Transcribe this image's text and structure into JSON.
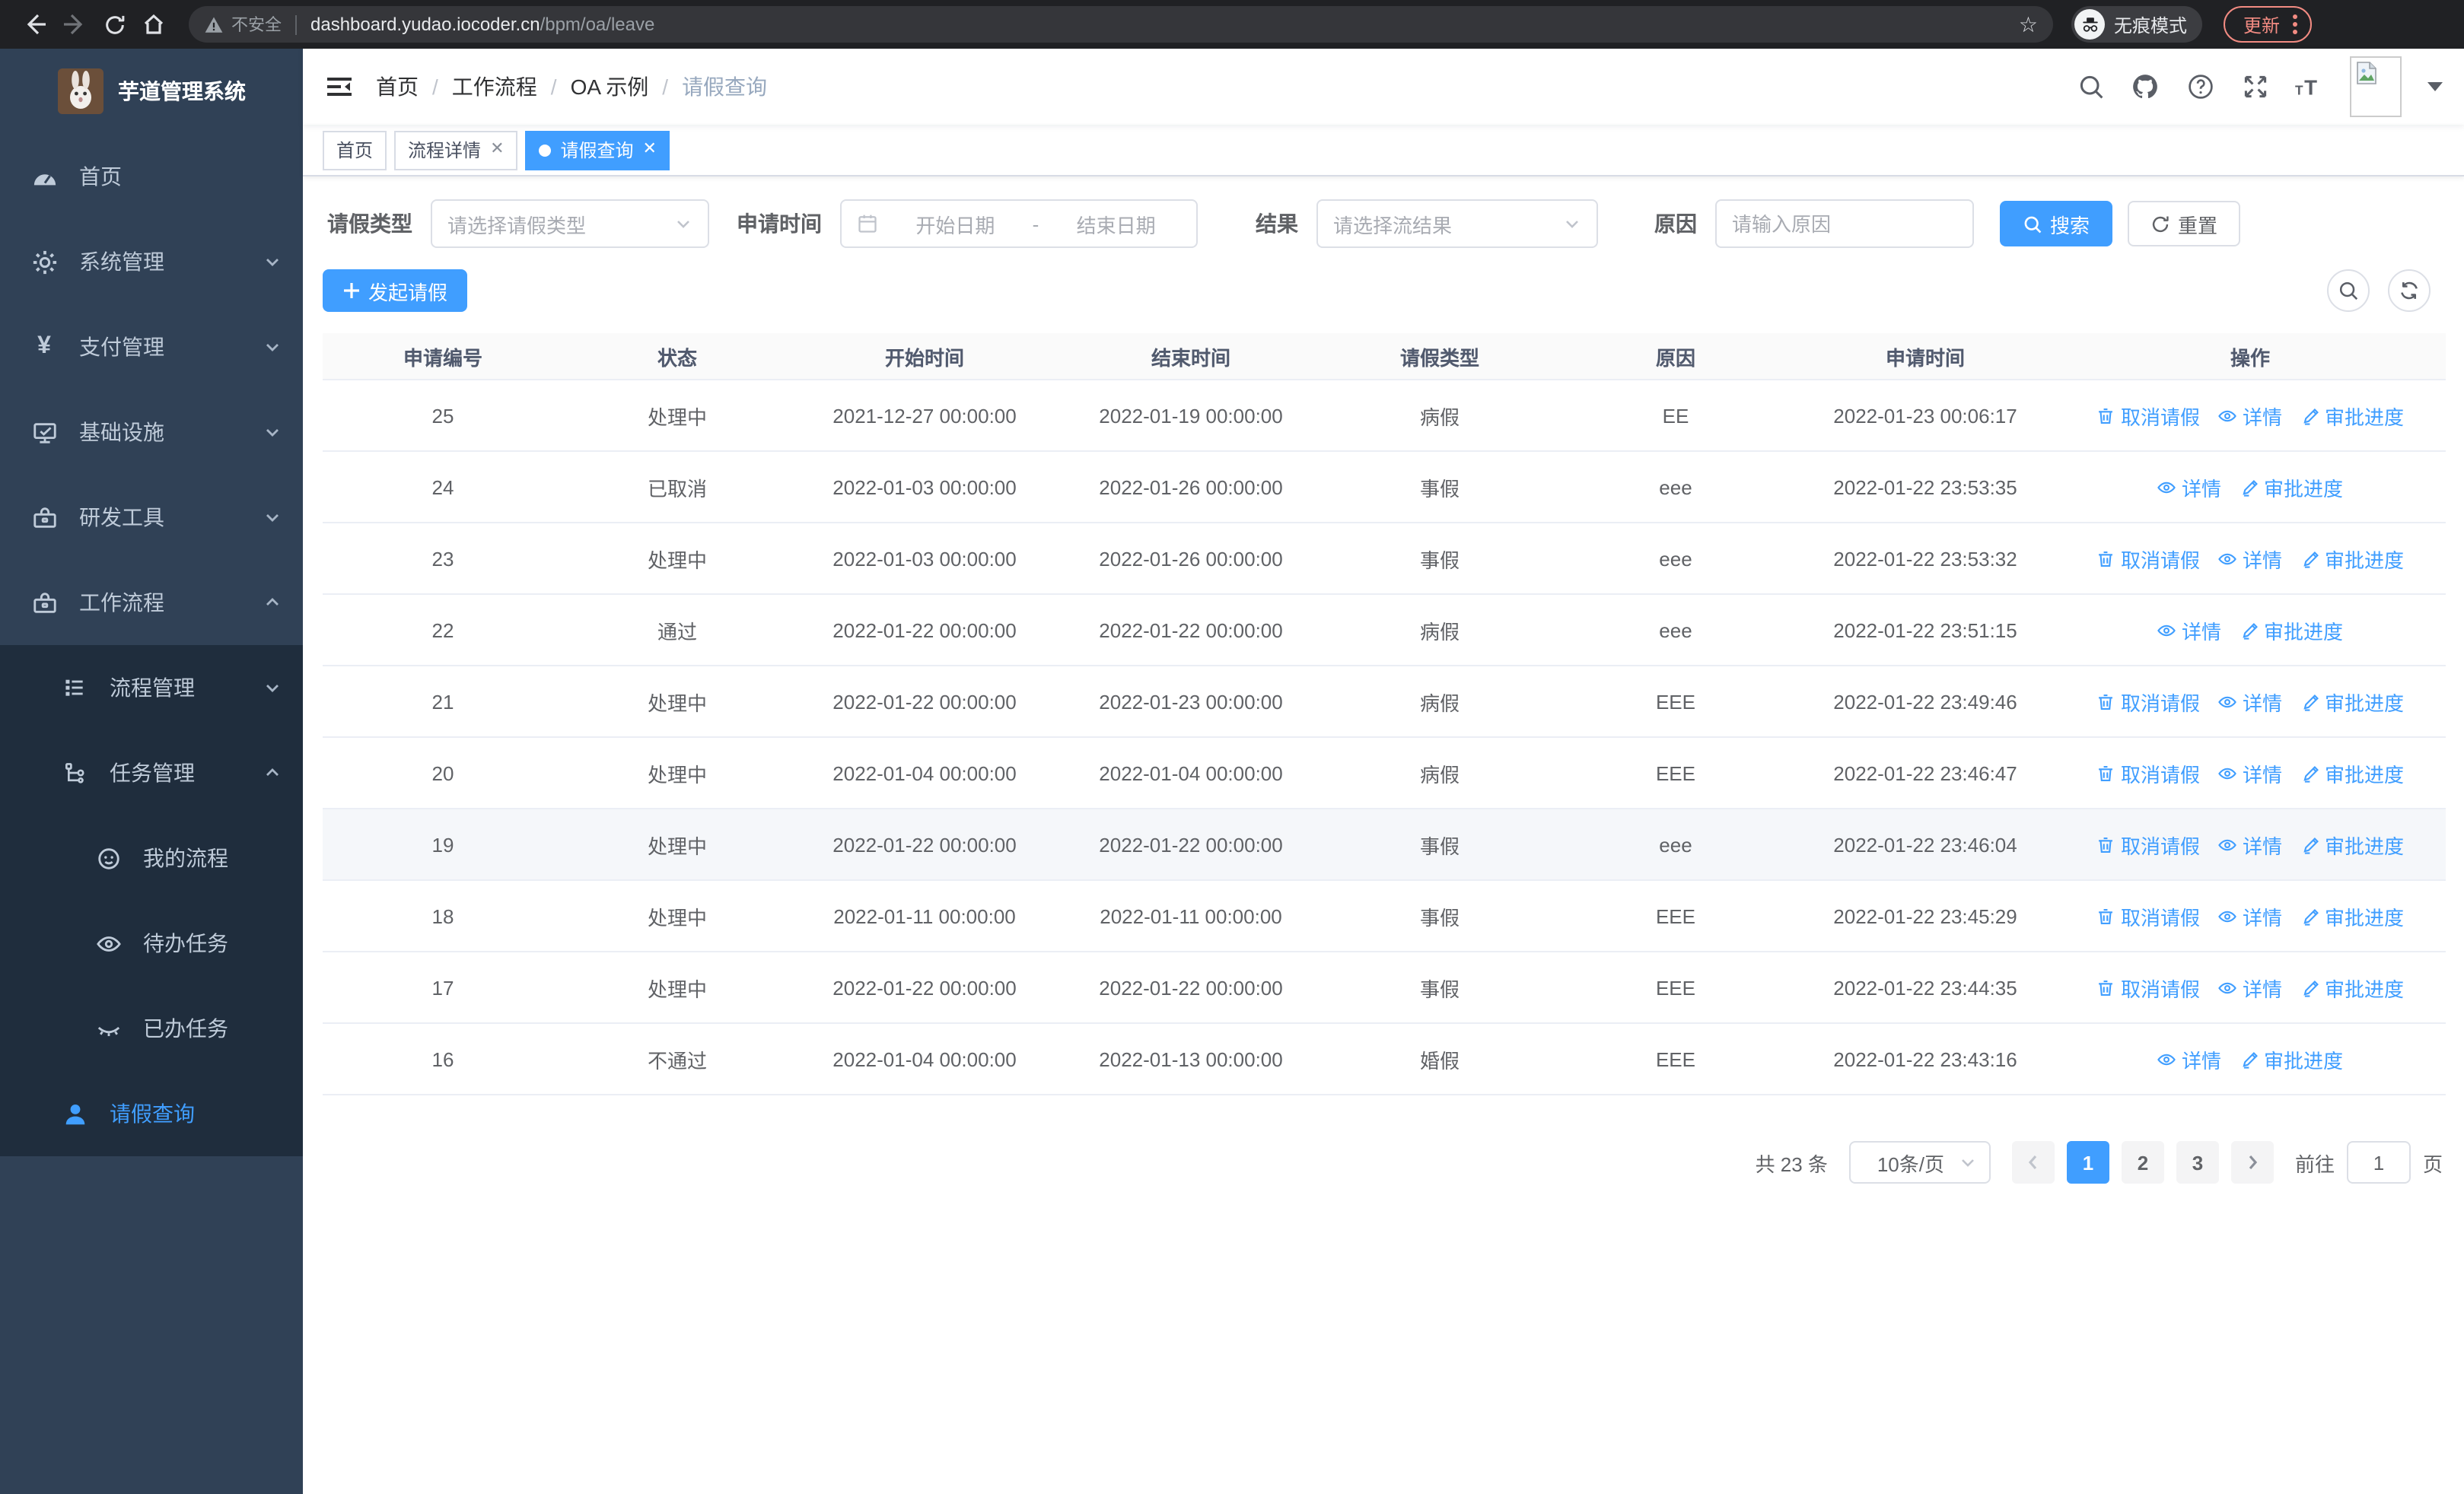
{
  "browser": {
    "security_label": "不安全",
    "url_host": "dashboard.yudao.iocoder.cn",
    "url_path": "/bpm/oa/leave",
    "incognito_label": "无痕模式",
    "update_label": "更新"
  },
  "sidebar": {
    "title": "芋道管理系统",
    "items": [
      {
        "label": "首页",
        "icon": "dashboard-icon"
      },
      {
        "label": "系统管理",
        "icon": "gear-icon"
      },
      {
        "label": "支付管理",
        "icon": "yen-icon"
      },
      {
        "label": "基础设施",
        "icon": "monitor-icon"
      },
      {
        "label": "研发工具",
        "icon": "toolbox-icon"
      },
      {
        "label": "工作流程",
        "icon": "briefcase-icon"
      }
    ],
    "workflow_children": [
      {
        "label": "流程管理",
        "icon": "list-icon"
      },
      {
        "label": "任务管理",
        "icon": "flow-icon"
      },
      {
        "label": "我的流程",
        "icon": "face-icon"
      },
      {
        "label": "待办任务",
        "icon": "eye-icon"
      },
      {
        "label": "已办任务",
        "icon": "eye-closed-icon"
      },
      {
        "label": "请假查询",
        "icon": "user-icon"
      }
    ]
  },
  "navbar": {
    "breadcrumb": [
      "首页",
      "工作流程",
      "OA 示例",
      "请假查询"
    ]
  },
  "tabs": [
    {
      "label": "首页"
    },
    {
      "label": "流程详情"
    },
    {
      "label": "请假查询"
    }
  ],
  "filters": {
    "leave_type_label": "请假类型",
    "leave_type_placeholder": "请选择请假类型",
    "apply_time_label": "申请时间",
    "start_date_placeholder": "开始日期",
    "range_separator": "-",
    "end_date_placeholder": "结束日期",
    "result_label": "结果",
    "result_placeholder": "请选择流结果",
    "reason_label": "原因",
    "reason_placeholder": "请输入原因",
    "search_label": "搜索",
    "reset_label": "重置"
  },
  "toolbar": {
    "create_label": "发起请假"
  },
  "table": {
    "headers": [
      "申请编号",
      "状态",
      "开始时间",
      "结束时间",
      "请假类型",
      "原因",
      "申请时间",
      "操作"
    ],
    "keys": [
      "id",
      "status",
      "start",
      "end",
      "type",
      "reason",
      "applied"
    ],
    "action_labels": {
      "cancel": "取消请假",
      "detail": "详情",
      "progress": "审批进度"
    },
    "rows": [
      {
        "id": "25",
        "status": "处理中",
        "start": "2021-12-27 00:00:00",
        "end": "2022-01-19 00:00:00",
        "type": "病假",
        "reason": "EE",
        "applied": "2022-01-23 00:06:17",
        "highlight": false,
        "actions": [
          {
            "label": "取消请假",
            "icon": "delete-icon"
          },
          {
            "label": "详情",
            "icon": "view-icon"
          },
          {
            "label": "审批进度",
            "icon": "edit-icon"
          }
        ]
      },
      {
        "id": "24",
        "status": "已取消",
        "start": "2022-01-03 00:00:00",
        "end": "2022-01-26 00:00:00",
        "type": "事假",
        "reason": "eee",
        "applied": "2022-01-22 23:53:35",
        "highlight": false,
        "actions": [
          {
            "label": "详情",
            "icon": "view-icon"
          },
          {
            "label": "审批进度",
            "icon": "edit-icon"
          }
        ]
      },
      {
        "id": "23",
        "status": "处理中",
        "start": "2022-01-03 00:00:00",
        "end": "2022-01-26 00:00:00",
        "type": "事假",
        "reason": "eee",
        "applied": "2022-01-22 23:53:32",
        "highlight": false,
        "actions": [
          {
            "label": "取消请假",
            "icon": "delete-icon"
          },
          {
            "label": "详情",
            "icon": "view-icon"
          },
          {
            "label": "审批进度",
            "icon": "edit-icon"
          }
        ]
      },
      {
        "id": "22",
        "status": "通过",
        "start": "2022-01-22 00:00:00",
        "end": "2022-01-22 00:00:00",
        "type": "病假",
        "reason": "eee",
        "applied": "2022-01-22 23:51:15",
        "highlight": false,
        "actions": [
          {
            "label": "详情",
            "icon": "view-icon"
          },
          {
            "label": "审批进度",
            "icon": "edit-icon"
          }
        ]
      },
      {
        "id": "21",
        "status": "处理中",
        "start": "2022-01-22 00:00:00",
        "end": "2022-01-23 00:00:00",
        "type": "病假",
        "reason": "EEE",
        "applied": "2022-01-22 23:49:46",
        "highlight": false,
        "actions": [
          {
            "label": "取消请假",
            "icon": "delete-icon"
          },
          {
            "label": "详情",
            "icon": "view-icon"
          },
          {
            "label": "审批进度",
            "icon": "edit-icon"
          }
        ]
      },
      {
        "id": "20",
        "status": "处理中",
        "start": "2022-01-04 00:00:00",
        "end": "2022-01-04 00:00:00",
        "type": "病假",
        "reason": "EEE",
        "applied": "2022-01-22 23:46:47",
        "highlight": false,
        "actions": [
          {
            "label": "取消请假",
            "icon": "delete-icon"
          },
          {
            "label": "详情",
            "icon": "view-icon"
          },
          {
            "label": "审批进度",
            "icon": "edit-icon"
          }
        ]
      },
      {
        "id": "19",
        "status": "处理中",
        "start": "2022-01-22 00:00:00",
        "end": "2022-01-22 00:00:00",
        "type": "事假",
        "reason": "eee",
        "applied": "2022-01-22 23:46:04",
        "highlight": true,
        "actions": [
          {
            "label": "取消请假",
            "icon": "delete-icon"
          },
          {
            "label": "详情",
            "icon": "view-icon"
          },
          {
            "label": "审批进度",
            "icon": "edit-icon"
          }
        ]
      },
      {
        "id": "18",
        "status": "处理中",
        "start": "2022-01-11 00:00:00",
        "end": "2022-01-11 00:00:00",
        "type": "事假",
        "reason": "EEE",
        "applied": "2022-01-22 23:45:29",
        "highlight": false,
        "actions": [
          {
            "label": "取消请假",
            "icon": "delete-icon"
          },
          {
            "label": "详情",
            "icon": "view-icon"
          },
          {
            "label": "审批进度",
            "icon": "edit-icon"
          }
        ]
      },
      {
        "id": "17",
        "status": "处理中",
        "start": "2022-01-22 00:00:00",
        "end": "2022-01-22 00:00:00",
        "type": "事假",
        "reason": "EEE",
        "applied": "2022-01-22 23:44:35",
        "highlight": false,
        "actions": [
          {
            "label": "取消请假",
            "icon": "delete-icon"
          },
          {
            "label": "详情",
            "icon": "view-icon"
          },
          {
            "label": "审批进度",
            "icon": "edit-icon"
          }
        ]
      },
      {
        "id": "16",
        "status": "不通过",
        "start": "2022-01-04 00:00:00",
        "end": "2022-01-13 00:00:00",
        "type": "婚假",
        "reason": "EEE",
        "applied": "2022-01-22 23:43:16",
        "highlight": false,
        "actions": [
          {
            "label": "详情",
            "icon": "view-icon"
          },
          {
            "label": "审批进度",
            "icon": "edit-icon"
          }
        ]
      }
    ]
  },
  "pagination": {
    "total_label": "共 23 条",
    "page_size": "10条/页",
    "pages": [
      "1",
      "2",
      "3"
    ],
    "active_page": "1",
    "goto_label": "前往",
    "goto_value": "1",
    "page_suffix": "页"
  },
  "colors": {
    "primary": "#409EFF",
    "sidebar_bg": "#304156",
    "sidebar_sub_bg": "#1f2d3d",
    "update_accent": "#f28b82"
  }
}
